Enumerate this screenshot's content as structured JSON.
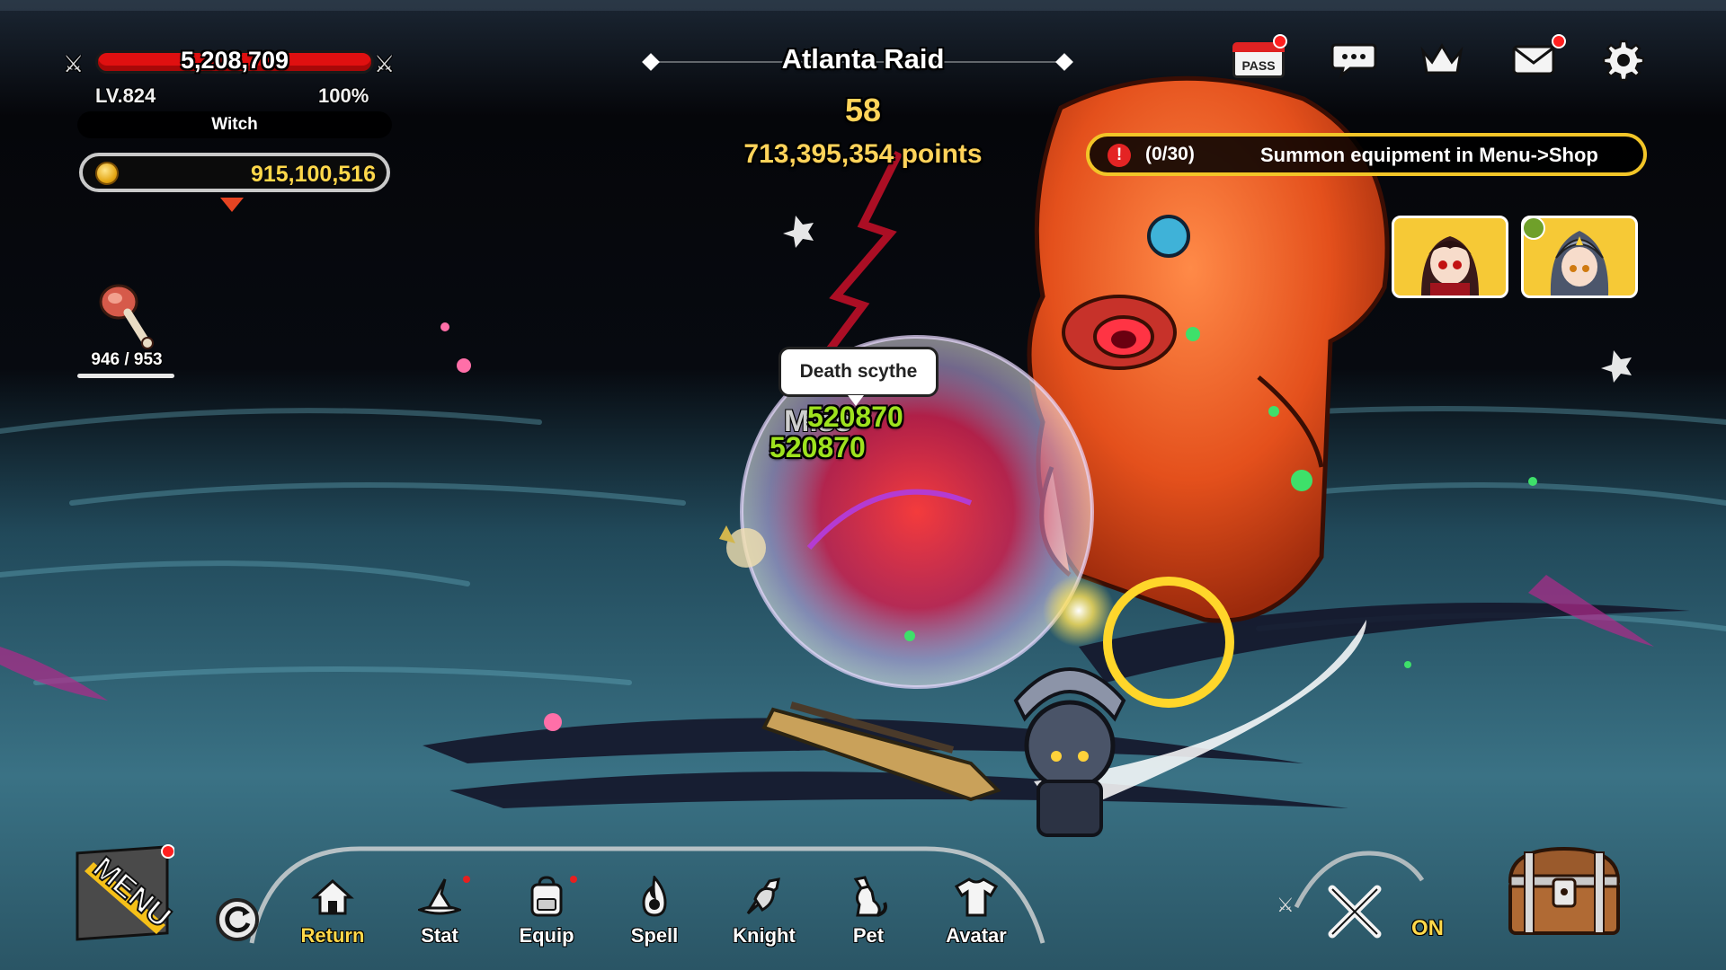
{
  "player": {
    "hp": "5,208,709",
    "level": "LV.824",
    "exp_percent": "100%",
    "class_name": "Witch",
    "gold": "915,100,516",
    "stamina": "946 / 953"
  },
  "raid": {
    "title": "Atlanta Raid",
    "timer": "58",
    "points": "713,395,354 points"
  },
  "quest": {
    "alert": "!",
    "progress": "(0/30)",
    "text": "Summon equipment in Menu->Shop"
  },
  "top_icons": {
    "pass_label": "PASS"
  },
  "battle": {
    "skill_bubble": "Death scythe",
    "miss_text": "Miss",
    "damage_1": "520870",
    "damage_2": "520870"
  },
  "nav": {
    "menu_label": "MENU",
    "items": [
      {
        "label": "Return",
        "icon": "home-icon"
      },
      {
        "label": "Stat",
        "icon": "witch-hat-icon"
      },
      {
        "label": "Equip",
        "icon": "backpack-icon"
      },
      {
        "label": "Spell",
        "icon": "flame-icon"
      },
      {
        "label": "Knight",
        "icon": "knight-icon"
      },
      {
        "label": "Pet",
        "icon": "cat-icon"
      },
      {
        "label": "Avatar",
        "icon": "shirt-icon"
      }
    ],
    "auto_label": "ON"
  },
  "colors": {
    "gold_text": "#ffd84a",
    "hp_bar": "#e01010",
    "quest_border": "#f2c528",
    "damage_text": "#9ee21e"
  }
}
